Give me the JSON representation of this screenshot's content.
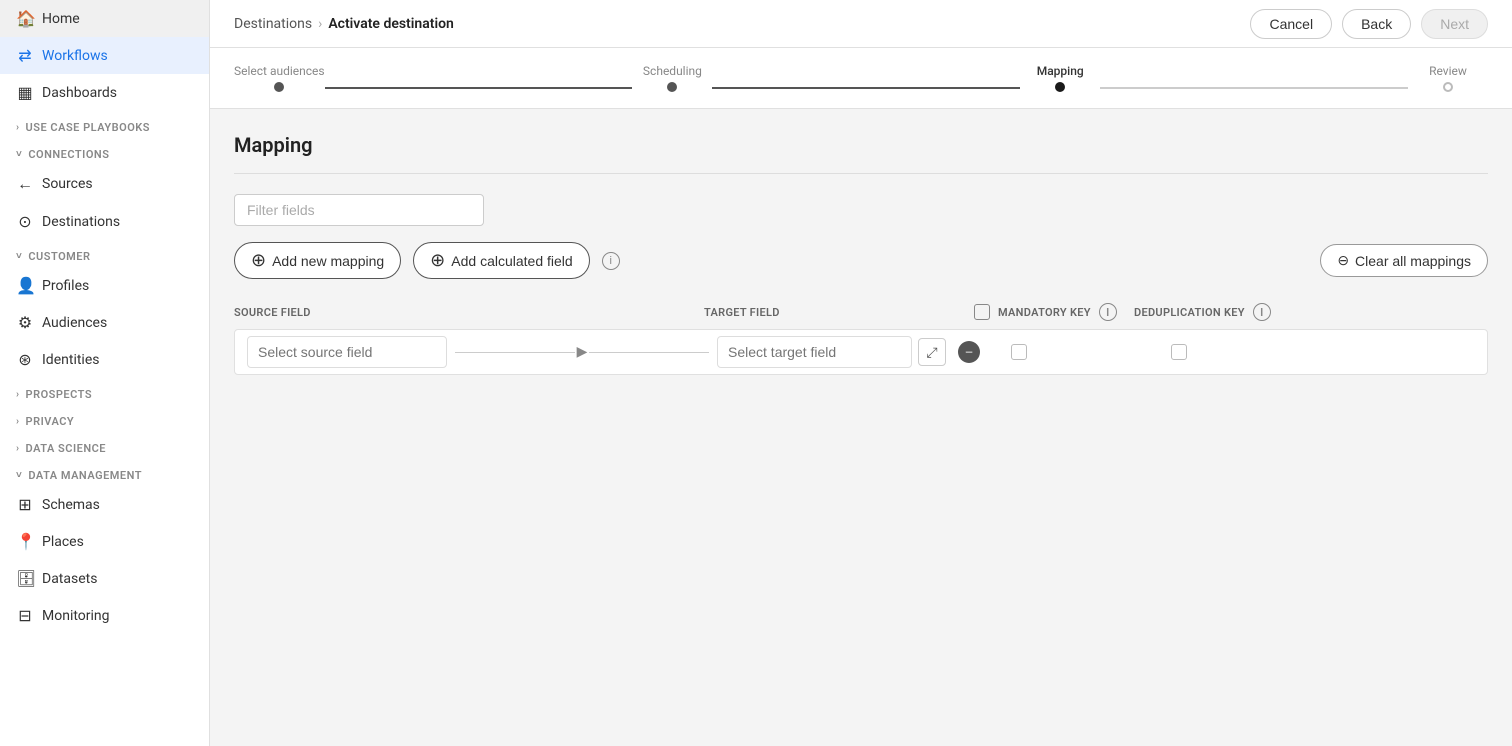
{
  "sidebar": {
    "home_label": "Home",
    "workflows_label": "Workflows",
    "dashboards_label": "Dashboards",
    "use_case_playbooks_label": "USE CASE PLAYBOOKS",
    "connections_label": "CONNECTIONS",
    "sources_label": "Sources",
    "destinations_label": "Destinations",
    "customer_label": "CUSTOMER",
    "profiles_label": "Profiles",
    "audiences_label": "Audiences",
    "identities_label": "Identities",
    "prospects_label": "PROSPECTS",
    "privacy_label": "PRIVACY",
    "data_science_label": "DATA SCIENCE",
    "data_management_label": "DATA MANAGEMENT",
    "schemas_label": "Schemas",
    "places_label": "Places",
    "datasets_label": "Datasets",
    "monitoring_label": "Monitoring"
  },
  "topbar": {
    "breadcrumb_parent": "Destinations",
    "breadcrumb_separator": "›",
    "breadcrumb_current": "Activate destination",
    "cancel_label": "Cancel",
    "back_label": "Back",
    "next_label": "Next"
  },
  "stepper": {
    "steps": [
      {
        "label": "Select audiences",
        "state": "completed"
      },
      {
        "label": "Scheduling",
        "state": "completed"
      },
      {
        "label": "Mapping",
        "state": "active"
      },
      {
        "label": "Review",
        "state": "empty"
      }
    ]
  },
  "mapping": {
    "title": "Mapping",
    "filter_placeholder": "Filter fields",
    "add_new_mapping_label": "Add new mapping",
    "add_calculated_field_label": "Add calculated field",
    "clear_all_mappings_label": "Clear all mappings",
    "source_field_header": "SOURCE FIELD",
    "target_field_header": "TARGET FIELD",
    "mandatory_key_header": "MANDATORY KEY",
    "deduplication_key_header": "DEDUPLICATION KEY",
    "row": {
      "source_placeholder": "Select source field",
      "target_placeholder": "Select target field"
    }
  }
}
